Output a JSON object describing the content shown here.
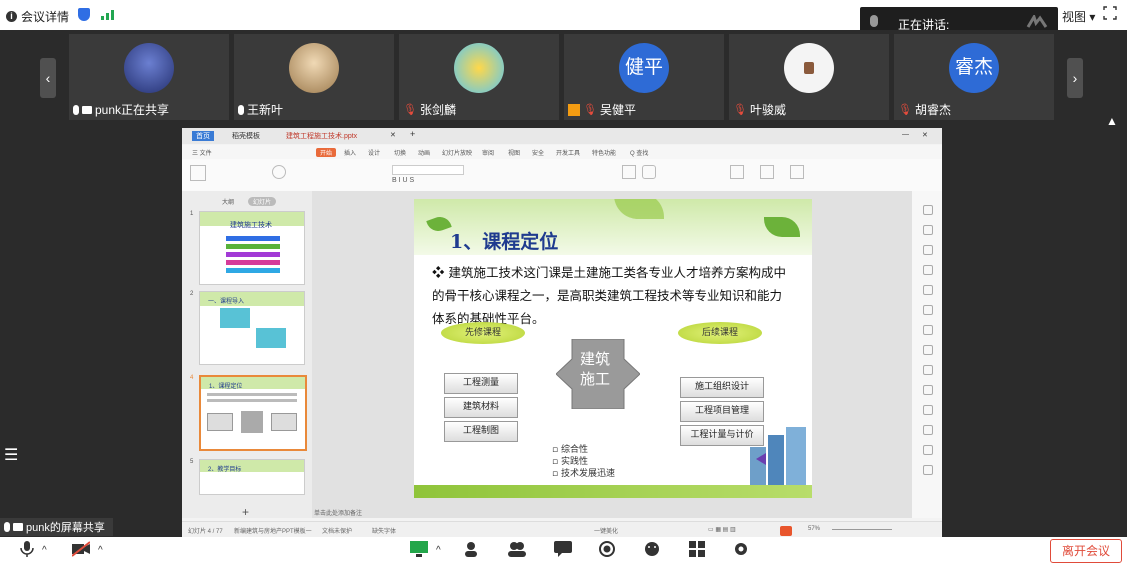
{
  "topbar": {
    "info_label": "会议详情",
    "view_label": "视图"
  },
  "speaking": {
    "label": "正在讲话:"
  },
  "participants": [
    {
      "name": "punk正在共享",
      "avatar": "image",
      "mic": true,
      "screen": true
    },
    {
      "name": "王新叶",
      "avatar": "image",
      "mic": true
    },
    {
      "name": "张剑麟",
      "avatar": "image",
      "mic": false
    },
    {
      "name": "吴健平",
      "avatar": "text",
      "avatar_text": "健平",
      "mic": false,
      "host": true
    },
    {
      "name": "叶骏威",
      "avatar": "image",
      "mic": false
    },
    {
      "name": "胡睿杰",
      "avatar": "text",
      "avatar_text": "睿杰",
      "mic": false
    }
  ],
  "wps": {
    "tabs": [
      "首页",
      "稻壳模板",
      "建筑工程施工技术.pptx"
    ],
    "menu": [
      "三 文件",
      "开始",
      "插入",
      "设计",
      "切换",
      "动画",
      "幻灯片放映",
      "审阅",
      "视图",
      "安全",
      "开发工具",
      "特色功能",
      "Q 查找"
    ],
    "left_tabs": [
      "大纲",
      "幻灯片"
    ],
    "status_left": "幻灯片 4 / 77",
    "status_theme": "新编建筑与房地产PPT模板一",
    "status_doc": "文档未保护",
    "status_font": "缺失字体",
    "status_beauty": "一键美化",
    "status_zoom": "57%",
    "notes": "单击此处添加备注"
  },
  "slide": {
    "title": "1、课程定位",
    "body": "建筑施工技术这门课是土建施工类各专业人才培养方案构成中的骨干核心课程之一，是高职类建筑工程技术等专业知识和能力体系的基础性平台。",
    "prev_oval": "先修课程",
    "next_oval": "后续课程",
    "left_boxes": [
      "工程测量",
      "建筑材料",
      "工程制图"
    ],
    "center_line1": "建筑",
    "center_line2": "施工",
    "right_boxes": [
      "施工组织设计",
      "工程项目管理",
      "工程计量与计价"
    ],
    "bullets": [
      "综合性",
      "实践性",
      "技术发展迅速"
    ]
  },
  "thumbs": [
    {
      "num": "1",
      "title": "建筑施工技术"
    },
    {
      "num": "2",
      "title": "一、课程导入"
    },
    {
      "num": "4",
      "title": "1、课程定位"
    },
    {
      "num": "5",
      "title": "2、教学目标"
    }
  ],
  "sharer": {
    "label": "punk的屏幕共享"
  },
  "bottom": {
    "leave_label": "离开会议"
  }
}
